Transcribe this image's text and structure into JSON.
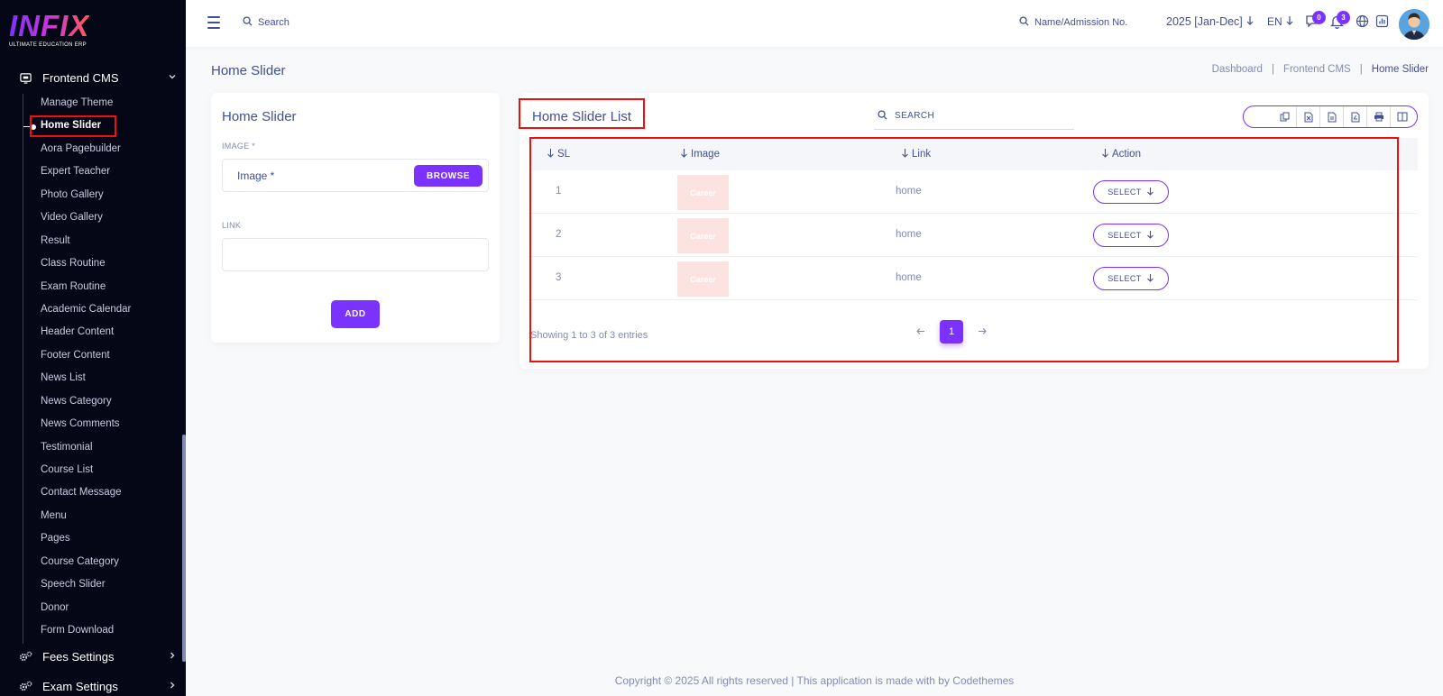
{
  "brand": {
    "logo": "INFIX",
    "tagline": "ULTIMATE EDUCATION ERP"
  },
  "sidebar": {
    "group_frontend": "Frontend CMS",
    "items": [
      {
        "label": "Manage Theme"
      },
      {
        "label": "Home Slider",
        "active": true
      },
      {
        "label": "Aora Pagebuilder"
      },
      {
        "label": "Expert Teacher"
      },
      {
        "label": "Photo Gallery"
      },
      {
        "label": "Video Gallery"
      },
      {
        "label": "Result"
      },
      {
        "label": "Class Routine"
      },
      {
        "label": "Exam Routine"
      },
      {
        "label": "Academic Calendar"
      },
      {
        "label": "Header Content"
      },
      {
        "label": "Footer Content"
      },
      {
        "label": "News List"
      },
      {
        "label": "News Category"
      },
      {
        "label": "News Comments"
      },
      {
        "label": "Testimonial"
      },
      {
        "label": "Course List"
      },
      {
        "label": "Contact Message"
      },
      {
        "label": "Menu"
      },
      {
        "label": "Pages"
      },
      {
        "label": "Course Category"
      },
      {
        "label": "Speech Slider"
      },
      {
        "label": "Donor"
      },
      {
        "label": "Form Download"
      }
    ],
    "group_fees": "Fees Settings",
    "group_exam": "Exam Settings"
  },
  "topbar": {
    "search": "Search",
    "name_search": "Name/Admission No.",
    "session": "2025 [Jan-Dec]",
    "lang": "EN",
    "messages_count": "0",
    "notifications_count": "3"
  },
  "page": {
    "title": "Home Slider",
    "breadcrumb": [
      "Dashboard",
      "Frontend CMS",
      "Home Slider"
    ]
  },
  "form": {
    "title": "Home Slider",
    "image_label": "IMAGE *",
    "image_placeholder": "Image *",
    "browse": "BROWSE",
    "link_label": "LINK",
    "link_value": "",
    "add": "ADD"
  },
  "list": {
    "title": "Home Slider List",
    "search": "SEARCH",
    "columns": [
      "SL",
      "Image",
      "Link",
      "Action"
    ],
    "rows": [
      {
        "sl": "1",
        "image_text": "Career",
        "link": "home",
        "action": "SELECT"
      },
      {
        "sl": "2",
        "image_text": "Career",
        "link": "home",
        "action": "SELECT"
      },
      {
        "sl": "3",
        "image_text": "Career",
        "link": "home",
        "action": "SELECT"
      }
    ],
    "showing": "Showing 1 to 3 of 3 entries",
    "page": "1"
  },
  "footer": "Copyright © 2025 All rights reserved | This application is made with by Codethemes",
  "colors": {
    "accent": "#7c32ff",
    "sidebar_bg": "#060716",
    "text": "#415094",
    "highlight": "#ee0f0f"
  }
}
